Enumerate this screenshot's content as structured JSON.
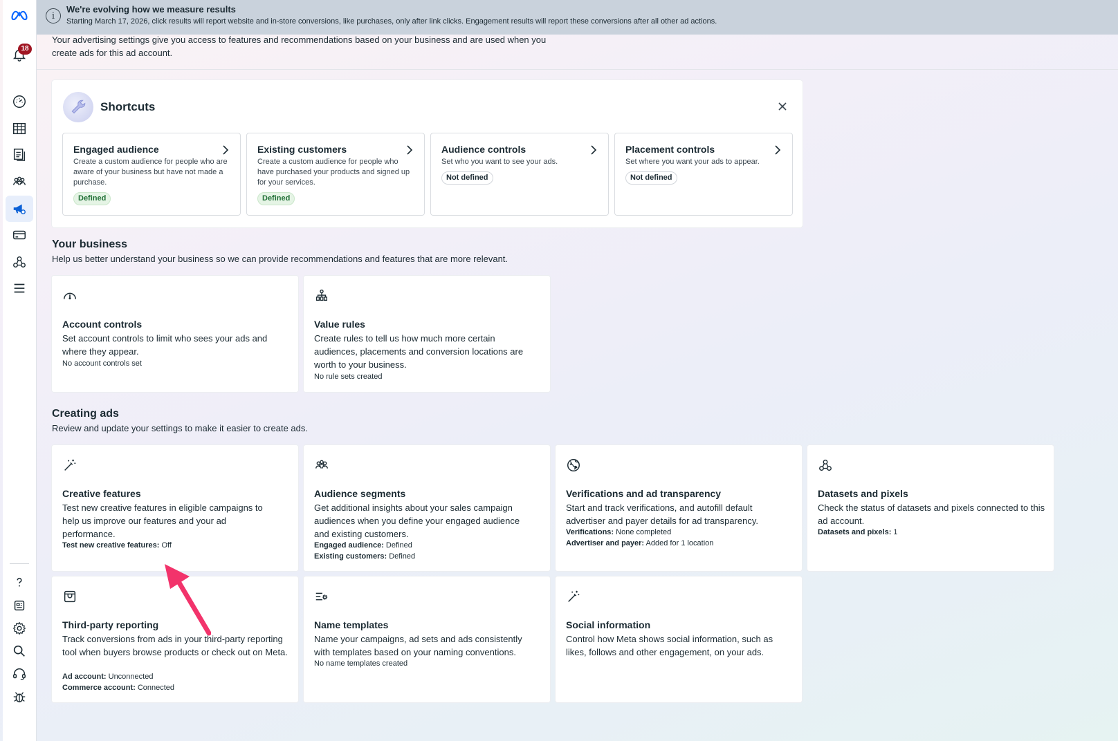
{
  "sidebar": {
    "notification_count": "18",
    "items": [
      "meta-logo",
      "notifications",
      "dashboard",
      "table",
      "documents",
      "audiences",
      "advertising-settings",
      "billing",
      "connections",
      "menu",
      "help",
      "news",
      "settings",
      "search",
      "support",
      "bug-report"
    ]
  },
  "banner": {
    "title": "We're evolving how we measure results",
    "body": "Starting March 17, 2026, click results will report website and in-store conversions, like purchases, only after link clicks. Engagement results will report these conversions after all other ad actions."
  },
  "intro": "Your advertising settings give you access to features and recommendations based on your business and are used when you create ads for this ad account.",
  "shortcuts": {
    "title": "Shortcuts",
    "cards": [
      {
        "title": "Engaged audience",
        "desc": "Create a custom audience for people who are aware of your business but have not made a purchase.",
        "status": "Defined"
      },
      {
        "title": "Existing customers",
        "desc": "Create a custom audience for people who have purchased your products and signed up for your services.",
        "status": "Defined"
      },
      {
        "title": "Audience controls",
        "desc": "Set who you want to see your ads.",
        "status": "Not defined"
      },
      {
        "title": "Placement controls",
        "desc": "Set where you want your ads to appear.",
        "status": "Not defined"
      }
    ]
  },
  "your_business": {
    "title": "Your business",
    "subtitle": "Help us better understand your business so we can provide recommendations and features that are more relevant.",
    "account_controls": {
      "title": "Account controls",
      "desc": "Set account controls to limit who sees your ads and where they appear.",
      "meta": "No account controls set"
    },
    "value_rules": {
      "title": "Value rules",
      "desc": "Create rules to tell us how much more certain audiences, placements and conversion locations are worth to your business.",
      "meta": "No rule sets created"
    }
  },
  "creating_ads": {
    "title": "Creating ads",
    "subtitle": "Review and update your settings to make it easier to create ads.",
    "creative_features": {
      "title": "Creative features",
      "desc": "Test new creative features in eligible campaigns to help us improve our features and your ad performance.",
      "meta_label": "Test new creative features:",
      "meta_value": " Off"
    },
    "audience_segments": {
      "title": "Audience segments",
      "desc": "Get additional insights about your sales campaign audiences when you define your engaged audience and existing customers.",
      "meta1_label": "Engaged audience:",
      "meta1_value": " Defined",
      "meta2_label": "Existing customers:",
      "meta2_value": " Defined"
    },
    "verifications": {
      "title": "Verifications and ad transparency",
      "desc": "Start and track verifications, and autofill default advertiser and payer details for ad transparency.",
      "meta1_label": "Verifications:",
      "meta1_value": " None completed",
      "meta2_label": "Advertiser and payer:",
      "meta2_value": " Added for 1 location"
    },
    "datasets": {
      "title": "Datasets and pixels",
      "desc": "Check the status of datasets and pixels connected to this ad account.",
      "meta_label": "Datasets and pixels:",
      "meta_value": " 1"
    },
    "third_party": {
      "title": "Third-party reporting",
      "desc": "Track conversions from ads in your third-party reporting tool when buyers browse products or check out on Meta.",
      "meta1_label": "Ad account:",
      "meta1_value": " Unconnected",
      "meta2_label": "Commerce account:",
      "meta2_value": " Connected"
    },
    "name_templates": {
      "title": "Name templates",
      "desc": "Name your campaigns, ad sets and ads consistently with templates based on your naming conventions.",
      "meta": "No name templates created"
    },
    "social_info": {
      "title": "Social information",
      "desc": "Control how Meta shows social information, such as likes, follows and other engagement, on your ads."
    }
  },
  "colors": {
    "accent": "#0a60d6",
    "arrow": "#f2336b",
    "badge": "#a01522",
    "defined_bg": "#e5f4e5"
  }
}
